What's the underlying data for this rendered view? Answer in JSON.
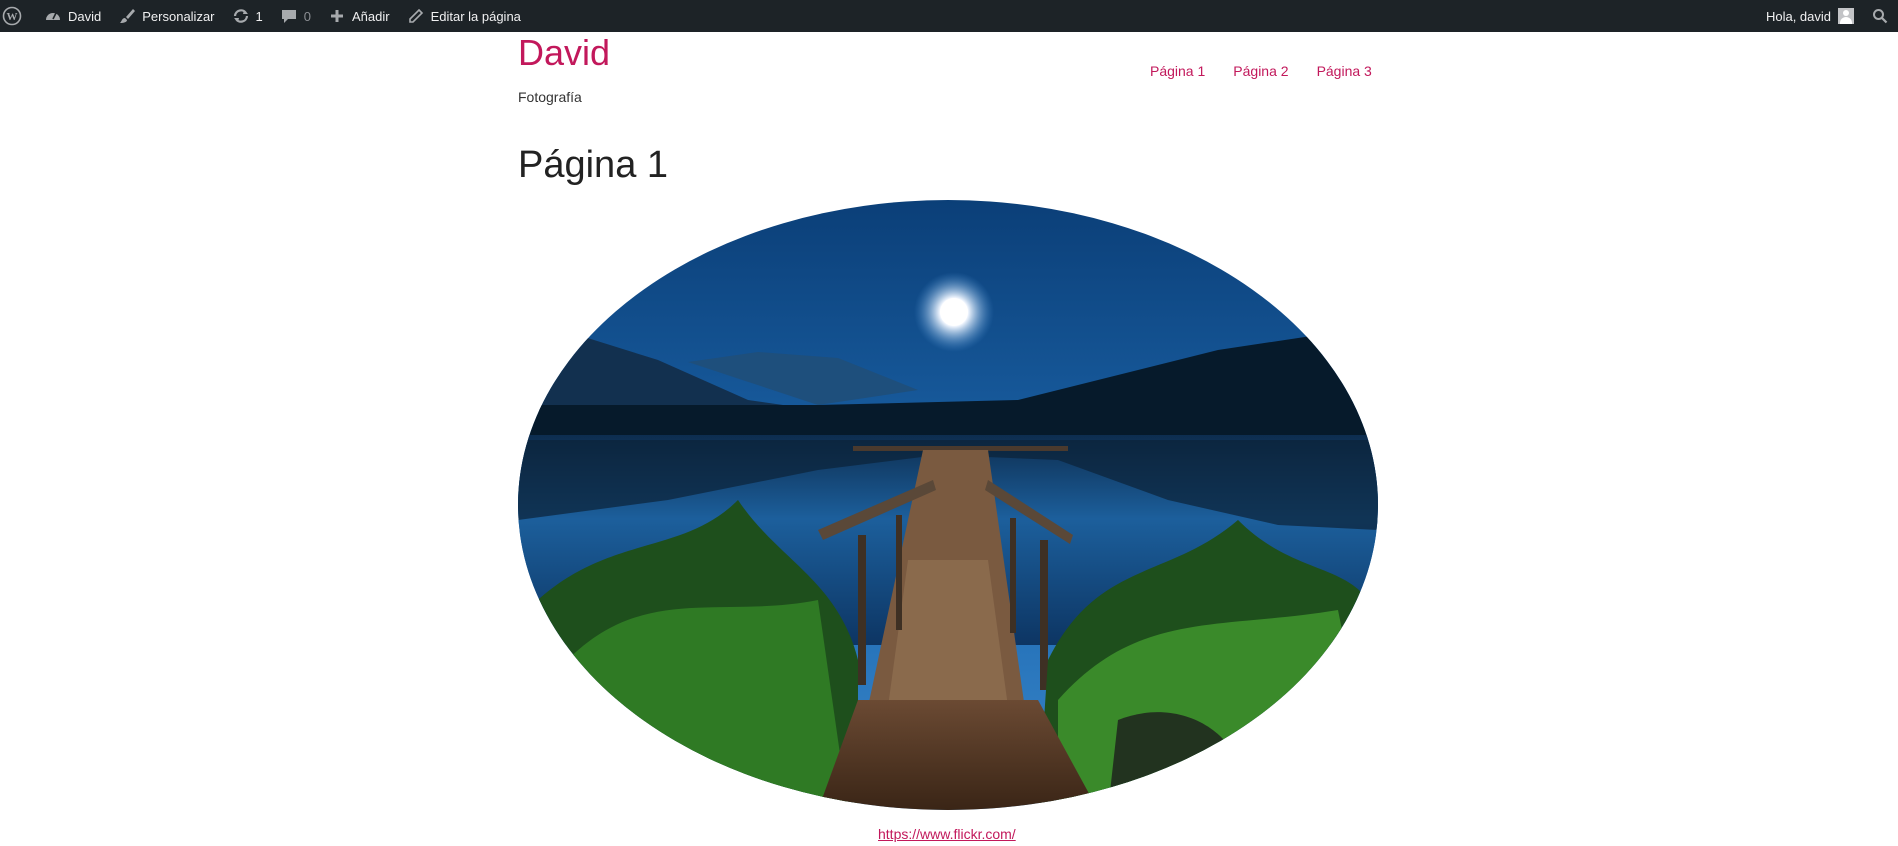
{
  "adminbar": {
    "wp_logo_icon": "wordpress-logo-icon",
    "site_name": "David",
    "customize": "Personalizar",
    "updates_count": "1",
    "comments_count": "0",
    "new": "Añadir",
    "edit": "Editar la página",
    "greeting": "Hola, david"
  },
  "site": {
    "title": "David",
    "tagline": "Fotografía"
  },
  "nav": [
    "Página 1",
    "Página 2",
    "Página 3"
  ],
  "page": {
    "title": "Página 1",
    "link_text": "https://www.flickr.com/"
  },
  "colors": {
    "adminbar_bg": "#1d2327",
    "accent": "#c2185b"
  }
}
